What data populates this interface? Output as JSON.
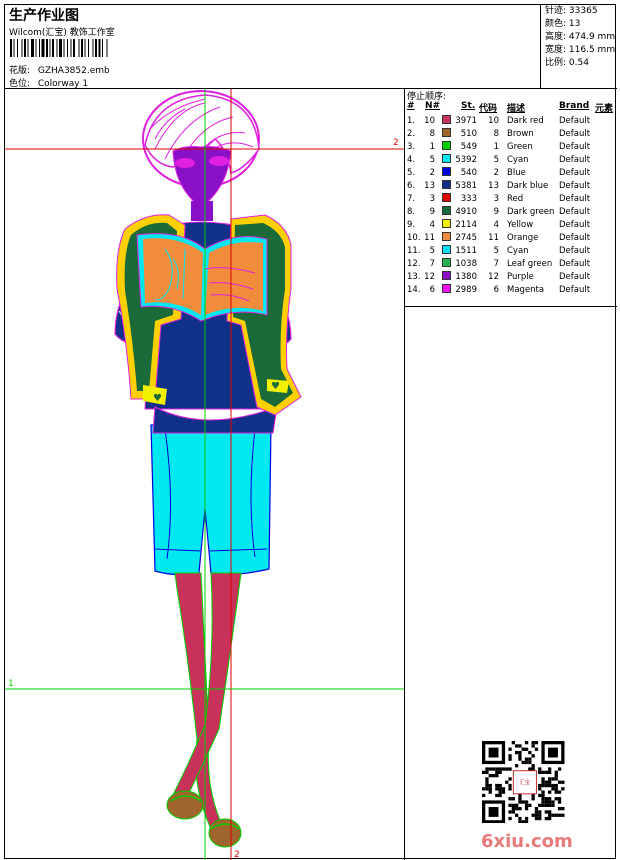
{
  "header": {
    "title": "生产作业图",
    "company": "Wilcom(汇宝) 教饰工作室",
    "design_label": "花版:",
    "design_value": "GZHA3852.emb",
    "colorway_label": "色位:",
    "colorway_value": "Colorway 1"
  },
  "stats": [
    {
      "label": "针迹:",
      "value": "33365"
    },
    {
      "label": "颜色:",
      "value": "13"
    },
    {
      "label": "高度:",
      "value": "474.9 mm"
    },
    {
      "label": "宽度:",
      "value": "116.5 mm"
    },
    {
      "label": "比例:",
      "value": "0.54"
    }
  ],
  "stop_sequence": {
    "title": "停止顺序:",
    "headers": [
      "#",
      "N#",
      "St.",
      "代码",
      "描述",
      "Brand",
      "元素"
    ],
    "rows": [
      {
        "idx": "1.",
        "n": "10",
        "st": "3971",
        "code": "10",
        "desc": "Dark red",
        "brand": "Default",
        "color": "#c8325a"
      },
      {
        "idx": "2.",
        "n": "8",
        "st": "510",
        "code": "8",
        "desc": "Brown",
        "brand": "Default",
        "color": "#a0642d"
      },
      {
        "idx": "3.",
        "n": "1",
        "st": "549",
        "code": "1",
        "desc": "Green",
        "brand": "Default",
        "color": "#00d000"
      },
      {
        "idx": "4.",
        "n": "5",
        "st": "5392",
        "code": "5",
        "desc": "Cyan",
        "brand": "Default",
        "color": "#00e8f0"
      },
      {
        "idx": "5.",
        "n": "2",
        "st": "540",
        "code": "2",
        "desc": "Blue",
        "brand": "Default",
        "color": "#0000e0"
      },
      {
        "idx": "6.",
        "n": "13",
        "st": "5381",
        "code": "13",
        "desc": "Dark blue",
        "brand": "Default",
        "color": "#10308a"
      },
      {
        "idx": "7.",
        "n": "3",
        "st": "333",
        "code": "3",
        "desc": "Red",
        "brand": "Default",
        "color": "#e00000"
      },
      {
        "idx": "8.",
        "n": "9",
        "st": "4910",
        "code": "9",
        "desc": "Dark green",
        "brand": "Default",
        "color": "#1a6a3a"
      },
      {
        "idx": "9.",
        "n": "4",
        "st": "2114",
        "code": "4",
        "desc": "Yellow",
        "brand": "Default",
        "color": "#f0f000"
      },
      {
        "idx": "10.",
        "n": "11",
        "st": "2745",
        "code": "11",
        "desc": "Orange",
        "brand": "Default",
        "color": "#f08c3c"
      },
      {
        "idx": "11.",
        "n": "5",
        "st": "1511",
        "code": "5",
        "desc": "Cyan",
        "brand": "Default",
        "color": "#00e0f0"
      },
      {
        "idx": "12.",
        "n": "7",
        "st": "1038",
        "code": "7",
        "desc": "Leaf green",
        "brand": "Default",
        "color": "#28b050"
      },
      {
        "idx": "13.",
        "n": "12",
        "st": "1380",
        "code": "12",
        "desc": "Purple",
        "brand": "Default",
        "color": "#8a10c8"
      },
      {
        "idx": "14.",
        "n": "6",
        "st": "2989",
        "code": "6",
        "desc": "Magenta",
        "brand": "Default",
        "color": "#f010f0"
      }
    ]
  },
  "guides": {
    "label_top": "2",
    "label_bottom": "2",
    "label_left": "1"
  },
  "watermark": "6xiu.com",
  "seal_text": "汇宝刺绣"
}
